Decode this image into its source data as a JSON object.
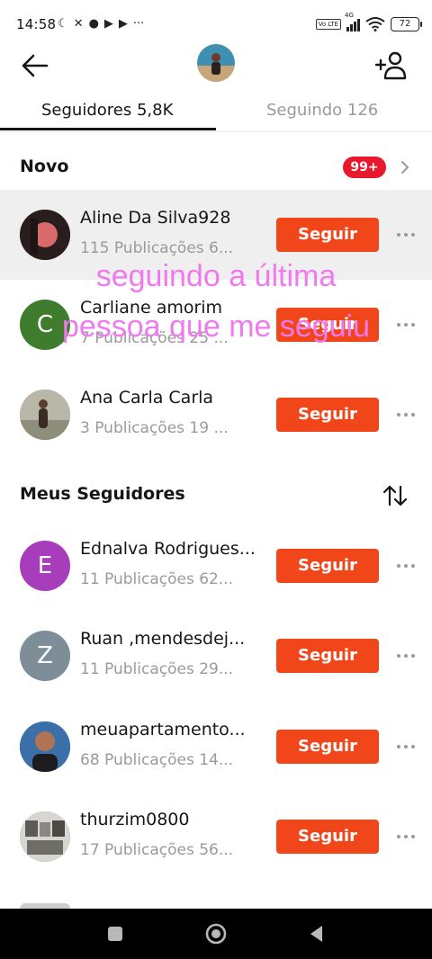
{
  "status_bar": {
    "time": "14:58",
    "left_icons": [
      "moon-icon",
      "mute-icon",
      "chat-icon",
      "play-icon",
      "play-icon",
      "more-dots-icon"
    ],
    "left_glyphs": [
      "☾",
      "✕",
      "●",
      "▶",
      "▶",
      "···"
    ],
    "network_label": "4G",
    "volte_label": "Vo LTE",
    "battery": "72"
  },
  "header": {
    "back_icon": "arrow-left-icon",
    "add_user_icon": "add-user-icon"
  },
  "tabs": [
    {
      "label": "Seguidores 5,8K",
      "active": true
    },
    {
      "label": "Seguindo 126",
      "active": false
    }
  ],
  "new_section": {
    "title": "Novo",
    "badge": "99+"
  },
  "new_followers": [
    {
      "name": "Aline Da Silva928",
      "meta": "115 Publicações   6...",
      "button": "Seguir",
      "avatar_letter": "",
      "avatar_color": "#6b3b42",
      "highlight": true
    },
    {
      "name": "Carliane amorim",
      "meta": "7 Publicações   25 ...",
      "button": "Seguir",
      "avatar_letter": "C",
      "avatar_color": "#3f7c2e",
      "highlight": false
    },
    {
      "name": "Ana Carla Carla",
      "meta": "3 Publicações   19 ...",
      "button": "Seguir",
      "avatar_letter": "",
      "avatar_color": "#9c9a8f",
      "highlight": false
    }
  ],
  "followers_section": {
    "title": "Meus Seguidores",
    "sort_icon": "sort-arrows-icon"
  },
  "followers": [
    {
      "name": "Ednalva Rodrigues...",
      "meta": "11 Publicações   62...",
      "button": "Seguir",
      "avatar_letter": "E",
      "avatar_color": "#a83dbc"
    },
    {
      "name": "Ruan ,mendesdej...",
      "meta": "11 Publicações   29...",
      "button": "Seguir",
      "avatar_letter": "Z",
      "avatar_color": "#7e8e98"
    },
    {
      "name": "meuapartamento...",
      "meta": "68 Publicações   14...",
      "button": "Seguir",
      "avatar_letter": "",
      "avatar_color": "#2f5a8a"
    },
    {
      "name": "thurzim0800",
      "meta": "17 Publicações   56...",
      "button": "Seguir",
      "avatar_letter": "",
      "avatar_color": "#6d6d6a"
    }
  ],
  "overlay_caption": {
    "line1": "seguindo a última",
    "line2": "pessoa que me seguiu"
  },
  "colors": {
    "follow_button": "#f1461a",
    "badge": "#e8192c",
    "overlay_text": "#ef7aef"
  }
}
